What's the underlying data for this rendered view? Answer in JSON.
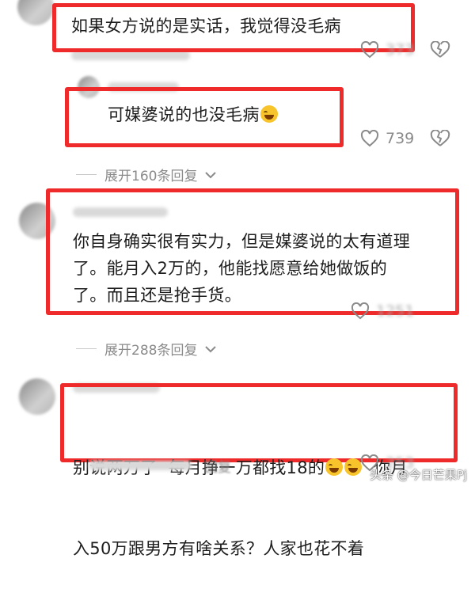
{
  "comments": [
    {
      "text": "如果女方说的是实话，我觉得没毛病",
      "likes": ""
    },
    {
      "text": "可媒婆说的也没毛病",
      "likes": "739"
    },
    {
      "lines": [
        "你自身确实很有实力，但是媒婆说的太有道理",
        "了。能月入2万的，他能找愿意给她做饭的",
        "了。而且还是抢手货。"
      ],
      "likes": ""
    },
    {
      "line1": "别说两万了  每月挣一万都找18的",
      "line1_tail": "  你月",
      "line2": "入50万跟男方有啥关系？人家也花不着",
      "likes": ""
    }
  ],
  "expand_1": "展开160条回复",
  "expand_2": "展开288条回复",
  "reply_label": "回复",
  "watermark": "头条 @今日芒果Pj",
  "icons": {
    "like": "heart-outline-icon",
    "dislike": "broken-heart-icon",
    "expand": "chevron-down-icon",
    "emoji": "laughing-crying-emoji"
  },
  "colors": {
    "highlight_box": "#ee2a2a",
    "meta_text": "#8a8a8a"
  }
}
